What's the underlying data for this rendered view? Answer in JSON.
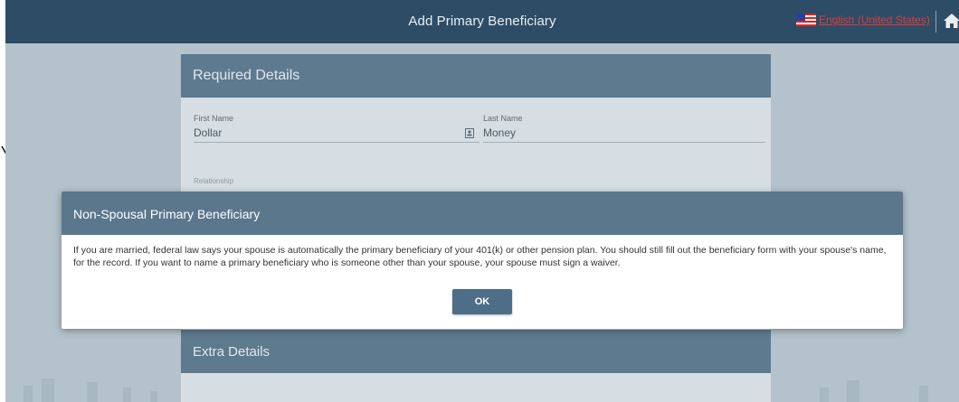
{
  "header": {
    "title": "Add Primary Beneficiary",
    "language_label": "English (United States)",
    "language_flag_icon": "us-flag-icon",
    "home_icon": "home-icon"
  },
  "form": {
    "required_section_title": "Required Details",
    "first_name_label": "First Name",
    "first_name_value": "Dollar",
    "last_name_label": "Last Name",
    "last_name_value": "Money",
    "relationship_label": "Relationship",
    "extra_section_title": "Extra Details"
  },
  "modal": {
    "title": "Non-Spousal Primary Beneficiary",
    "message": "If you are married, federal law says your spouse is automatically the primary beneficiary of your 401(k) or other pension plan. You should still fill out the beneficiary form with your spouse's name, for the record. If you want to name a primary beneficiary who is someone other than your spouse, your spouse must sign a waiver.",
    "ok_label": "OK"
  },
  "colors": {
    "header_bg": "#2d4d66",
    "overlay_bg": "#b3c2cb",
    "section_header": "#5e7a8f",
    "modal_header": "#5a778c",
    "ok_button": "#4d6e86",
    "language_link": "#e23a3a"
  }
}
